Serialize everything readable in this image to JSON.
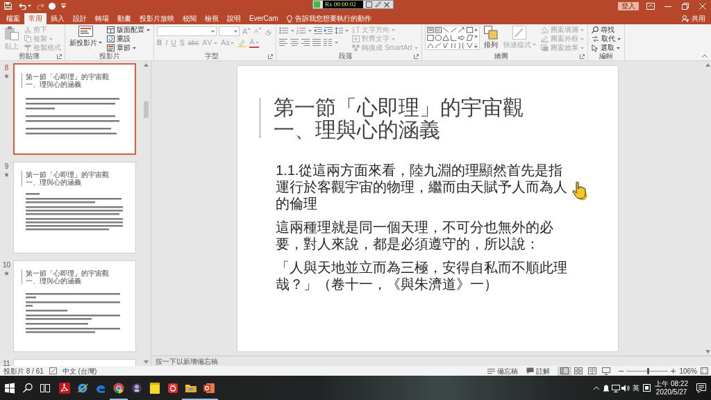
{
  "title_bar": {
    "recorder_reading": "Rx 00:00:02",
    "sign_in": "登入"
  },
  "tabs": [
    {
      "label": "檔案",
      "selected": false
    },
    {
      "label": "常用",
      "selected": true
    },
    {
      "label": "插入",
      "selected": false
    },
    {
      "label": "設計",
      "selected": false
    },
    {
      "label": "轉場",
      "selected": false
    },
    {
      "label": "動畫",
      "selected": false
    },
    {
      "label": "投影片放映",
      "selected": false
    },
    {
      "label": "校閱",
      "selected": false
    },
    {
      "label": "檢視",
      "selected": false
    },
    {
      "label": "說明",
      "selected": false
    },
    {
      "label": "EverCam",
      "selected": false
    }
  ],
  "tell_me": "告訴我您想要執行的動作",
  "share": "共用",
  "ribbon": {
    "clipboard": {
      "label": "剪貼簿",
      "paste": {
        "label": "貼上",
        "disabled": true
      },
      "items": [
        {
          "label": "剪下",
          "disabled": true
        },
        {
          "label": "複製",
          "disabled": true
        },
        {
          "label": "複製格式",
          "disabled": true
        }
      ]
    },
    "slides": {
      "label": "投影片",
      "new_slide": "新投影片",
      "items": [
        "版面配置",
        "重設",
        "章節"
      ]
    },
    "font": {
      "label": "字型",
      "size_buttons": [
        {
          "label": "A",
          "disabled": true
        },
        {
          "label": "A",
          "disabled": true
        }
      ],
      "format_buttons": [
        {
          "label": "B",
          "disabled": true
        },
        {
          "label": "I",
          "disabled": true
        },
        {
          "label": "U",
          "disabled": true
        },
        {
          "label": "S",
          "disabled": true
        },
        {
          "label": "abc",
          "disabled": true
        },
        {
          "label": "AV",
          "disabled": true
        },
        {
          "label": "Aa",
          "disabled": true
        },
        {
          "label": "A",
          "disabled": true
        }
      ]
    },
    "paragraph": {
      "label": "段落",
      "items": [
        {
          "label": "文字方向",
          "disabled": true
        },
        {
          "label": "對齊文字",
          "disabled": true
        },
        {
          "label": "轉換成 SmartArt",
          "disabled": true
        }
      ]
    },
    "drawing": {
      "label": "繪圖",
      "arrange": "排列",
      "quick_styles": {
        "label": "快速樣式",
        "disabled": true
      },
      "items": [
        {
          "label": "圖案填滿",
          "disabled": true
        },
        {
          "label": "圖案外框",
          "disabled": true
        },
        {
          "label": "圖案效果",
          "disabled": true
        }
      ]
    },
    "editing": {
      "label": "編輯",
      "items": [
        "尋找",
        "取代",
        "選取"
      ]
    }
  },
  "thumbnails": [
    {
      "number": "8",
      "selected": true,
      "title": "第一節「心即理」的宇宙觀一、理與心的涵義"
    },
    {
      "number": "9",
      "selected": false,
      "title": "第一節「心即理」的宇宙觀一、理與心的涵義"
    },
    {
      "number": "10",
      "selected": false,
      "title": "第一節「心即理」的宇宙觀一、理與心的涵義"
    },
    {
      "number": "11",
      "selected": false
    }
  ],
  "slide": {
    "title": "第一節「心即理」的宇宙觀一、理與心的涵義",
    "paragraphs": [
      "1.1.從這兩方面來看，陸九淵的理顯然首先是指運行於客觀宇宙的物理，繼而由天賦予人而為人的倫理",
      "這兩種理就是同一個天理，不可分也無外的必要，對人來說，都是必須遵守的，所以說：",
      "「人與天地並立而為三極，安得自私而不順此理哉？」（卷十一，《與朱濟道》一）"
    ]
  },
  "notes": {
    "placeholder": "按一下以新增備忘稿"
  },
  "status_bar": {
    "slide_info": "投影片 8 / 61",
    "language": "中文 (台灣)",
    "notes_button": "備忘稿",
    "comments_button": "註解",
    "views": [
      {
        "selected": true
      },
      {
        "selected": false
      },
      {
        "selected": false
      },
      {
        "selected": false
      }
    ],
    "zoom": {
      "level": 0.52,
      "reading": "106%"
    }
  },
  "taskbar": {
    "apps": [
      {
        "running": false
      },
      {
        "running": false
      },
      {
        "running": false
      },
      {
        "running": true
      },
      {
        "running": false
      },
      {
        "running": false
      },
      {
        "running": false
      },
      {
        "running": true
      },
      {
        "running": true
      }
    ],
    "ime": "英",
    "time": "上午 08:22",
    "date": "2020/5/27"
  }
}
